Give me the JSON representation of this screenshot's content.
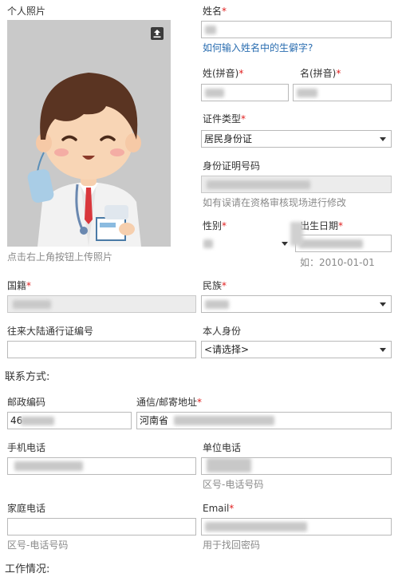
{
  "photo": {
    "label": "个人照片",
    "hint": "点击右上角按钮上传照片",
    "upload_icon": "upload-icon"
  },
  "name": {
    "label": "姓名",
    "required_mark": "*",
    "help_link": "如何输入姓名中的生僻字?"
  },
  "surname_pinyin": {
    "label": "姓(拼音)",
    "required_mark": "*"
  },
  "given_pinyin": {
    "label": "名(拼音)",
    "required_mark": "*"
  },
  "id_type": {
    "label": "证件类型",
    "required_mark": "*",
    "value": "居民身份证"
  },
  "id_number": {
    "label": "身份证明号码",
    "hint": "如有误请在资格审核现场进行修改"
  },
  "gender": {
    "label": "性别",
    "required_mark": "*"
  },
  "birth_date": {
    "label": "出生日期",
    "required_mark": "*",
    "hint": "如：2010-01-01"
  },
  "nationality": {
    "label": "国籍",
    "required_mark": "*"
  },
  "ethnicity": {
    "label": "民族",
    "required_mark": "*"
  },
  "mainland_permit": {
    "label": "往来大陆通行证编号"
  },
  "identity": {
    "label": "本人身份",
    "value": "<请选择>"
  },
  "contact_section": {
    "title": "联系方式:"
  },
  "postal_code": {
    "label": "邮政编码",
    "value": "46"
  },
  "address": {
    "label": "通信/邮寄地址",
    "required_mark": "*",
    "value": "河南省"
  },
  "mobile": {
    "label": "手机电话"
  },
  "work_phone": {
    "label": "单位电话",
    "hint": "区号-电话号码"
  },
  "home_phone": {
    "label": "家庭电话",
    "hint": "区号-电话号码"
  },
  "email": {
    "label": "Email",
    "required_mark": "*",
    "hint": "用于找回密码"
  },
  "work_section": {
    "title": "工作情况:"
  }
}
